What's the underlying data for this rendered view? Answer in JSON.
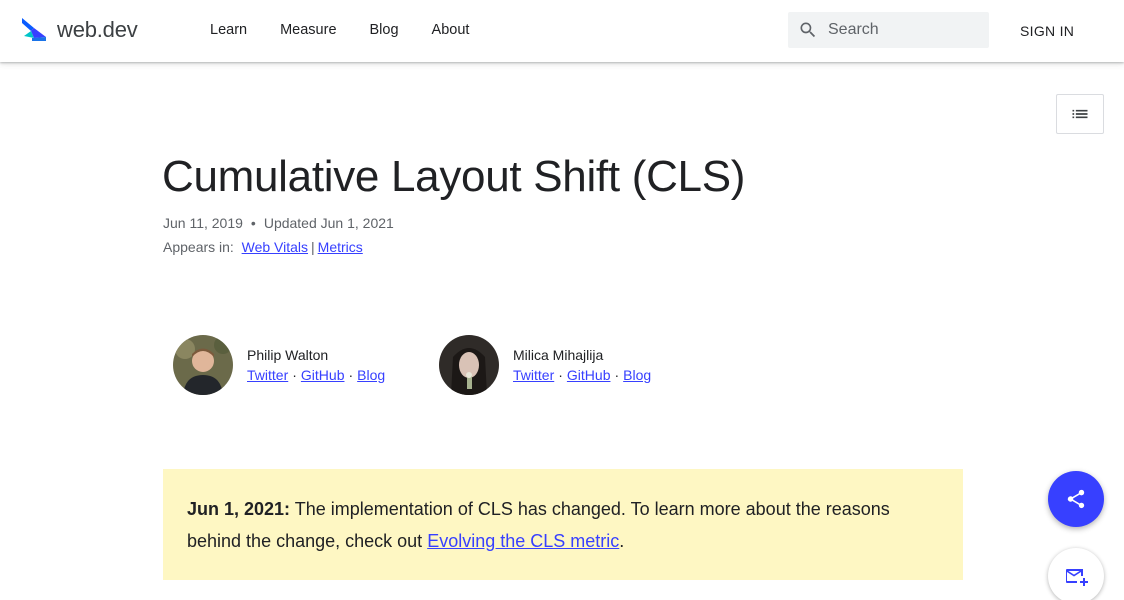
{
  "header": {
    "brand": "web.dev",
    "nav": [
      "Learn",
      "Measure",
      "Blog",
      "About"
    ],
    "search_placeholder": "Search",
    "sign_in": "SIGN IN"
  },
  "article": {
    "title": "Cumulative Layout Shift (CLS)",
    "published": "Jun 11, 2019",
    "updated": "Updated Jun 1, 2021",
    "appears_in_label": "Appears in:",
    "appears_in": [
      "Web Vitals",
      "Metrics"
    ],
    "separator": "|"
  },
  "authors": [
    {
      "name": "Philip Walton",
      "links": [
        "Twitter",
        "GitHub",
        "Blog"
      ]
    },
    {
      "name": "Milica Mihajlija",
      "links": [
        "Twitter",
        "GitHub",
        "Blog"
      ]
    }
  ],
  "callout": {
    "date": "Jun 1, 2021:",
    "text": " The implementation of CLS has changed. To learn more about the reasons behind the change, check out ",
    "link": "Evolving the CLS metric",
    "end": "."
  },
  "icons": {
    "logo": "web-dev-logo-icon",
    "search": "search-icon",
    "toc": "list-icon",
    "share": "share-icon",
    "subscribe": "mail-add-icon"
  },
  "colors": {
    "accent": "#3740ff",
    "callout_bg": "#fef7c3",
    "search_bg": "#f1f3f4"
  }
}
